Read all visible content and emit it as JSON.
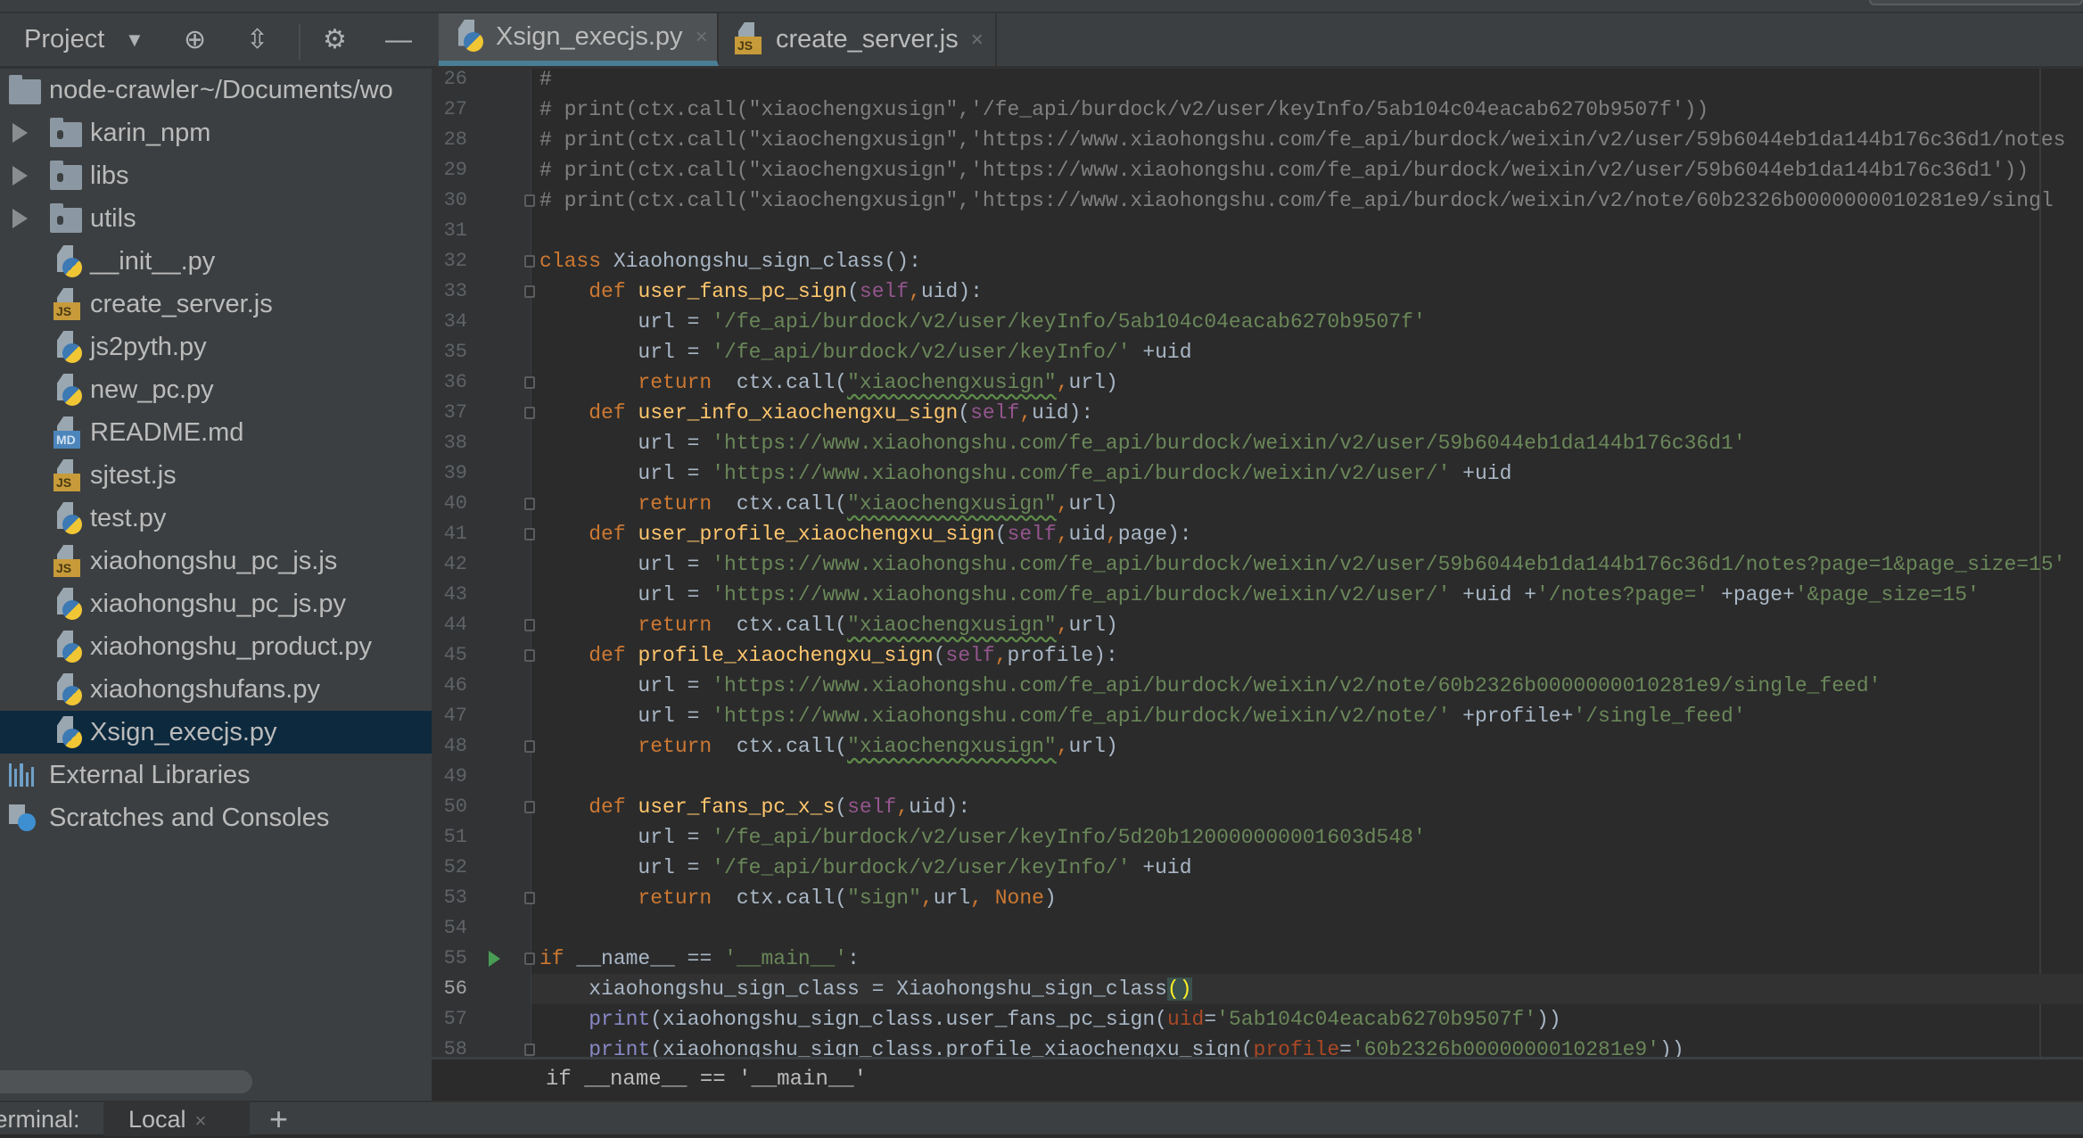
{
  "project_panel": {
    "title": "Project",
    "tree": [
      {
        "type": "root",
        "label": "node-crawler",
        "path": " ~/Documents/wo"
      },
      {
        "type": "folder",
        "label": "karin_npm"
      },
      {
        "type": "folder",
        "label": "libs"
      },
      {
        "type": "folder",
        "label": "utils"
      },
      {
        "type": "py",
        "label": "__init__.py"
      },
      {
        "type": "js",
        "label": "create_server.js"
      },
      {
        "type": "py",
        "label": "js2pyth.py"
      },
      {
        "type": "py",
        "label": "new_pc.py"
      },
      {
        "type": "md",
        "label": "README.md"
      },
      {
        "type": "js",
        "label": "sjtest.js"
      },
      {
        "type": "py",
        "label": "test.py"
      },
      {
        "type": "js",
        "label": "xiaohongshu_pc_js.js"
      },
      {
        "type": "py",
        "label": "xiaohongshu_pc_js.py"
      },
      {
        "type": "py",
        "label": "xiaohongshu_product.py"
      },
      {
        "type": "py",
        "label": "xiaohongshufans.py"
      },
      {
        "type": "py",
        "label": "Xsign_execjs.py",
        "selected": true
      },
      {
        "type": "ext",
        "label": "External Libraries"
      },
      {
        "type": "scratch",
        "label": "Scratches and Consoles"
      }
    ]
  },
  "tabs": [
    {
      "label": "Xsign_execjs.py",
      "type": "py",
      "active": true
    },
    {
      "label": "create_server.js",
      "type": "js",
      "active": false
    }
  ],
  "tab_close_glyph": "×",
  "editor": {
    "first_line": 26,
    "current_line": 56,
    "lines": [
      [
        [
          "c",
          "#"
        ]
      ],
      [
        [
          "c",
          "# print(ctx.call(\"xiaochengxusign\",'/fe_api/burdock/v2/user/keyInfo/5ab104c04eacab6270b9507f'))"
        ]
      ],
      [
        [
          "c",
          "# print(ctx.call(\"xiaochengxusign\",'https://www.xiaohongshu.com/fe_api/burdock/weixin/v2/user/59b6044eb1da144b176c36d1/notes"
        ]
      ],
      [
        [
          "c",
          "# print(ctx.call(\"xiaochengxusign\",'https://www.xiaohongshu.com/fe_api/burdock/weixin/v2/user/59b6044eb1da144b176c36d1'))"
        ]
      ],
      [
        [
          "c",
          "# print(ctx.call(\"xiaochengxusign\",'https://www.xiaohongshu.com/fe_api/burdock/weixin/v2/note/60b2326b0000000010281e9/singl"
        ]
      ],
      [],
      [
        [
          "k",
          "class "
        ],
        [
          "t",
          "Xiaohongshu_sign_class():"
        ]
      ],
      [
        [
          "t",
          "    "
        ],
        [
          "k",
          "def "
        ],
        [
          "f",
          "user_fans_pc_sign"
        ],
        [
          "t",
          "("
        ],
        [
          "p",
          "self"
        ],
        [
          "k",
          ","
        ],
        [
          "t",
          "uid):"
        ]
      ],
      [
        [
          "t",
          "        url = "
        ],
        [
          "s",
          "'/fe_api/burdock/v2/user/keyInfo/5ab104c04eacab6270b9507f'"
        ]
      ],
      [
        [
          "t",
          "        url = "
        ],
        [
          "s",
          "'/fe_api/burdock/v2/user/keyInfo/'"
        ],
        [
          "t",
          " +uid"
        ]
      ],
      [
        [
          "t",
          "        "
        ],
        [
          "k",
          "return"
        ],
        [
          "t",
          "  ctx.call("
        ],
        [
          "sw",
          "\"xiaochengxusign\""
        ],
        [
          "k",
          ","
        ],
        [
          "t",
          "url)"
        ]
      ],
      [
        [
          "t",
          "    "
        ],
        [
          "k",
          "def "
        ],
        [
          "f",
          "user_info_xiaochengxu_sign"
        ],
        [
          "t",
          "("
        ],
        [
          "p",
          "self"
        ],
        [
          "k",
          ","
        ],
        [
          "t",
          "uid):"
        ]
      ],
      [
        [
          "t",
          "        url = "
        ],
        [
          "s",
          "'https://www.xiaohongshu.com/fe_api/burdock/weixin/v2/user/59b6044eb1da144b176c36d1'"
        ]
      ],
      [
        [
          "t",
          "        url = "
        ],
        [
          "s",
          "'https://www.xiaohongshu.com/fe_api/burdock/weixin/v2/user/'"
        ],
        [
          "t",
          " +uid"
        ]
      ],
      [
        [
          "t",
          "        "
        ],
        [
          "k",
          "return"
        ],
        [
          "t",
          "  ctx.call("
        ],
        [
          "sw",
          "\"xiaochengxusign\""
        ],
        [
          "k",
          ","
        ],
        [
          "t",
          "url)"
        ]
      ],
      [
        [
          "t",
          "    "
        ],
        [
          "k",
          "def "
        ],
        [
          "f",
          "user_profile_xiaochengxu_sign"
        ],
        [
          "t",
          "("
        ],
        [
          "p",
          "self"
        ],
        [
          "k",
          ","
        ],
        [
          "t",
          "uid"
        ],
        [
          "k",
          ","
        ],
        [
          "t",
          "page):"
        ]
      ],
      [
        [
          "t",
          "        url = "
        ],
        [
          "s",
          "'https://www.xiaohongshu.com/fe_api/burdock/weixin/v2/user/59b6044eb1da144b176c36d1/notes?page=1&page_size=15'"
        ]
      ],
      [
        [
          "t",
          "        url = "
        ],
        [
          "s",
          "'https://www.xiaohongshu.com/fe_api/burdock/weixin/v2/user/'"
        ],
        [
          "t",
          " +uid +"
        ],
        [
          "s",
          "'/notes?page='"
        ],
        [
          "t",
          " +page+"
        ],
        [
          "s",
          "'&page_size=15'"
        ]
      ],
      [
        [
          "t",
          "        "
        ],
        [
          "k",
          "return"
        ],
        [
          "t",
          "  ctx.call("
        ],
        [
          "sw",
          "\"xiaochengxusign\""
        ],
        [
          "k",
          ","
        ],
        [
          "t",
          "url)"
        ]
      ],
      [
        [
          "t",
          "    "
        ],
        [
          "k",
          "def "
        ],
        [
          "f",
          "profile_xiaochengxu_sign"
        ],
        [
          "t",
          "("
        ],
        [
          "p",
          "self"
        ],
        [
          "k",
          ","
        ],
        [
          "t",
          "profile):"
        ]
      ],
      [
        [
          "t",
          "        url = "
        ],
        [
          "s",
          "'https://www.xiaohongshu.com/fe_api/burdock/weixin/v2/note/60b2326b0000000010281e9/single_feed'"
        ]
      ],
      [
        [
          "t",
          "        url = "
        ],
        [
          "s",
          "'https://www.xiaohongshu.com/fe_api/burdock/weixin/v2/note/'"
        ],
        [
          "t",
          " +profile+"
        ],
        [
          "s",
          "'/single_feed'"
        ]
      ],
      [
        [
          "t",
          "        "
        ],
        [
          "k",
          "return"
        ],
        [
          "t",
          "  ctx.call("
        ],
        [
          "sw",
          "\"xiaochengxusign\""
        ],
        [
          "k",
          ","
        ],
        [
          "t",
          "url)"
        ]
      ],
      [],
      [
        [
          "t",
          "    "
        ],
        [
          "k",
          "def "
        ],
        [
          "f",
          "user_fans_pc_x_s"
        ],
        [
          "t",
          "("
        ],
        [
          "p",
          "self"
        ],
        [
          "k",
          ","
        ],
        [
          "t",
          "uid):"
        ]
      ],
      [
        [
          "t",
          "        url = "
        ],
        [
          "s",
          "'/fe_api/burdock/v2/user/keyInfo/5d20b120000000001603d548'"
        ]
      ],
      [
        [
          "t",
          "        url = "
        ],
        [
          "s",
          "'/fe_api/burdock/v2/user/keyInfo/'"
        ],
        [
          "t",
          " +uid"
        ]
      ],
      [
        [
          "t",
          "        "
        ],
        [
          "k",
          "return"
        ],
        [
          "t",
          "  ctx.call("
        ],
        [
          "s",
          "\"sign\""
        ],
        [
          "k",
          ","
        ],
        [
          "t",
          "url"
        ],
        [
          "k",
          ", None"
        ],
        [
          "t",
          ")"
        ]
      ],
      [],
      [
        [
          "k",
          "if "
        ],
        [
          "t",
          "__name__ == "
        ],
        [
          "s",
          "'__main__'"
        ],
        [
          "t",
          ":"
        ]
      ],
      [
        [
          "t",
          "    xiaohongshu_sign_class = Xiaohongshu_sign_class"
        ],
        [
          "br",
          "()"
        ]
      ],
      [
        [
          "t",
          "    "
        ],
        [
          "b",
          "print"
        ],
        [
          "t",
          "(xiaohongshu_sign_class.user_fans_pc_sign("
        ],
        [
          "n",
          "uid"
        ],
        [
          "t",
          "="
        ],
        [
          "s",
          "'5ab104c04eacab6270b9507f'"
        ],
        [
          "t",
          "))"
        ]
      ],
      [
        [
          "t",
          "    "
        ],
        [
          "b",
          "print"
        ],
        [
          "t",
          "(xiaohongshu_sign_class.profile_xiaochengxu_sign("
        ],
        [
          "n",
          "profile"
        ],
        [
          "t",
          "="
        ],
        [
          "s",
          "'60b2326b0000000010281e9'"
        ],
        [
          "t",
          "))"
        ]
      ]
    ]
  },
  "breadcrumb": "if __name__ == '__main__'",
  "terminal": {
    "label": "Terminal:",
    "tab": "Local",
    "add": "+"
  }
}
